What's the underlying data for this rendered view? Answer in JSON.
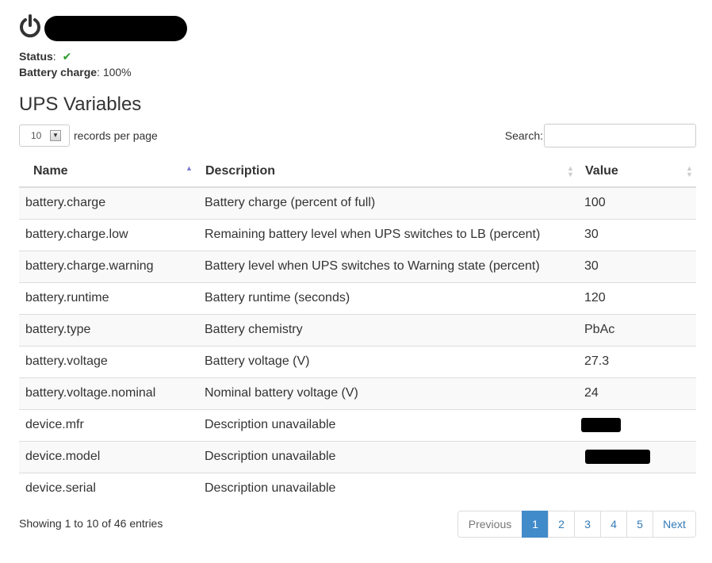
{
  "status": {
    "status_label": "Status",
    "status_suffix": ":",
    "status_icon": "checkmark-icon",
    "status_color": "#2a9d2a",
    "battery_charge_label": "Battery charge",
    "battery_charge_suffix": ":",
    "battery_charge_value": "100%"
  },
  "section": {
    "title": "UPS Variables"
  },
  "length_control": {
    "selected": "10",
    "label": "records per page"
  },
  "search": {
    "label": "Search:",
    "value": "",
    "placeholder": ""
  },
  "table": {
    "columns": [
      {
        "label": "Name",
        "sort": "ascending"
      },
      {
        "label": "Description",
        "sort": "none"
      },
      {
        "label": "Value",
        "sort": "none"
      }
    ],
    "rows": [
      {
        "name": "battery.charge",
        "description": "Battery charge (percent of full)",
        "value": "100"
      },
      {
        "name": "battery.charge.low",
        "description": "Remaining battery level when UPS switches to LB (percent)",
        "value": "30"
      },
      {
        "name": "battery.charge.warning",
        "description": "Battery level when UPS switches to Warning state (percent)",
        "value": "30"
      },
      {
        "name": "battery.runtime",
        "description": "Battery runtime (seconds)",
        "value": "120"
      },
      {
        "name": "battery.type",
        "description": "Battery chemistry",
        "value": "PbAc"
      },
      {
        "name": "battery.voltage",
        "description": "Battery voltage (V)",
        "value": "27.3"
      },
      {
        "name": "battery.voltage.nominal",
        "description": "Nominal battery voltage (V)",
        "value": "24"
      },
      {
        "name": "device.mfr",
        "description": "Description unavailable",
        "value": ""
      },
      {
        "name": "device.model",
        "description": "Description unavailable",
        "value": ""
      },
      {
        "name": "device.serial",
        "description": "Description unavailable",
        "value": ""
      }
    ]
  },
  "info": {
    "text": "Showing 1 to 10 of 46 entries"
  },
  "pagination": {
    "previous": "Previous",
    "pages": [
      "1",
      "2",
      "3",
      "4",
      "5"
    ],
    "active_page": "1",
    "next": "Next",
    "active_color": "#428bca",
    "link_color": "#337ab7"
  }
}
